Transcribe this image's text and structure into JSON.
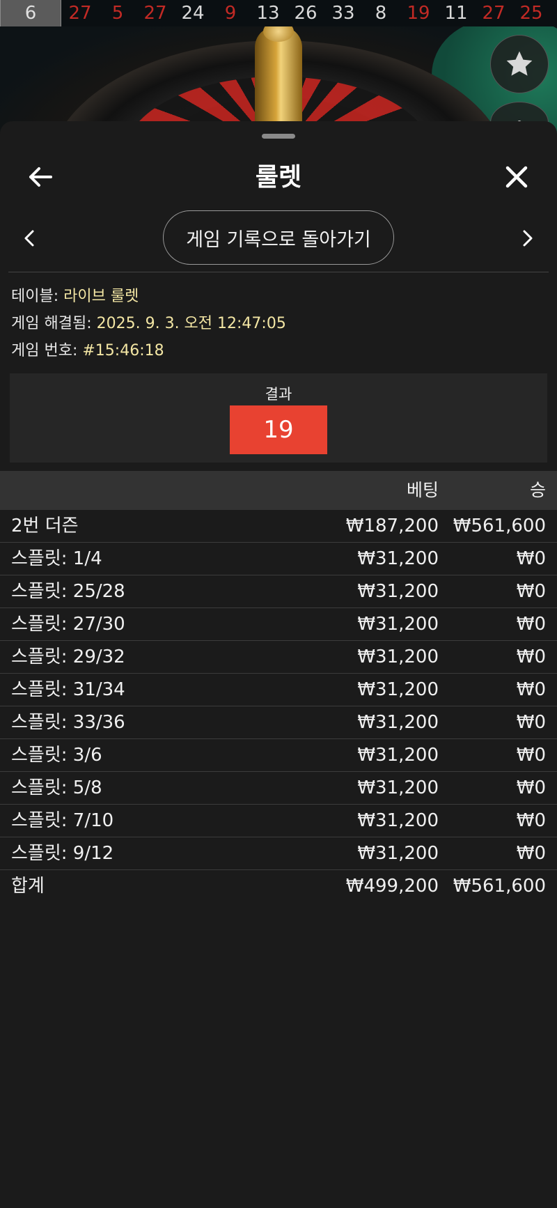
{
  "history": {
    "current": "6",
    "numbers": [
      {
        "value": "27",
        "color": "red"
      },
      {
        "value": "5",
        "color": "red"
      },
      {
        "value": "27",
        "color": "red"
      },
      {
        "value": "24",
        "color": "black"
      },
      {
        "value": "9",
        "color": "red"
      },
      {
        "value": "13",
        "color": "black"
      },
      {
        "value": "26",
        "color": "black"
      },
      {
        "value": "33",
        "color": "black"
      },
      {
        "value": "8",
        "color": "black"
      },
      {
        "value": "19",
        "color": "red"
      },
      {
        "value": "11",
        "color": "black"
      },
      {
        "value": "27",
        "color": "red"
      },
      {
        "value": "25",
        "color": "red"
      }
    ]
  },
  "header": {
    "title": "룰렛",
    "back_icon": "arrow-left-icon",
    "close_icon": "close-icon"
  },
  "nav": {
    "back_to_history_label": "게임 기록으로 돌아가기",
    "prev_icon": "chevron-left-icon",
    "next_icon": "chevron-right-icon"
  },
  "info": {
    "table_label": "테이블: ",
    "table_value": "라이브 룰렛",
    "resolved_label": "게임 해결됨: ",
    "resolved_value": "2025. 9. 3. 오전 12:47:05",
    "game_no_label": "게임 번호: ",
    "game_no_value": "#15:46:18"
  },
  "result": {
    "label": "결과",
    "number": "19",
    "color": "#e84231"
  },
  "bets_table": {
    "headers": {
      "bet": "베팅",
      "win": "승"
    },
    "rows": [
      {
        "name": "2번 더즌",
        "bet": "₩187,200",
        "win": "₩561,600"
      },
      {
        "name": "스플릿: 1/4",
        "bet": "₩31,200",
        "win": "₩0"
      },
      {
        "name": "스플릿: 25/28",
        "bet": "₩31,200",
        "win": "₩0"
      },
      {
        "name": "스플릿: 27/30",
        "bet": "₩31,200",
        "win": "₩0"
      },
      {
        "name": "스플릿: 29/32",
        "bet": "₩31,200",
        "win": "₩0"
      },
      {
        "name": "스플릿: 31/34",
        "bet": "₩31,200",
        "win": "₩0"
      },
      {
        "name": "스플릿: 33/36",
        "bet": "₩31,200",
        "win": "₩0"
      },
      {
        "name": "스플릿: 3/6",
        "bet": "₩31,200",
        "win": "₩0"
      },
      {
        "name": "스플릿: 5/8",
        "bet": "₩31,200",
        "win": "₩0"
      },
      {
        "name": "스플릿: 7/10",
        "bet": "₩31,200",
        "win": "₩0"
      },
      {
        "name": "스플릿: 9/12",
        "bet": "₩31,200",
        "win": "₩0"
      }
    ],
    "total": {
      "name": "합계",
      "bet": "₩499,200",
      "win": "₩561,600"
    }
  },
  "colors": {
    "red_number": "#c22a25",
    "accent_value": "#f3e6a4",
    "background": "#1b1b1b"
  }
}
